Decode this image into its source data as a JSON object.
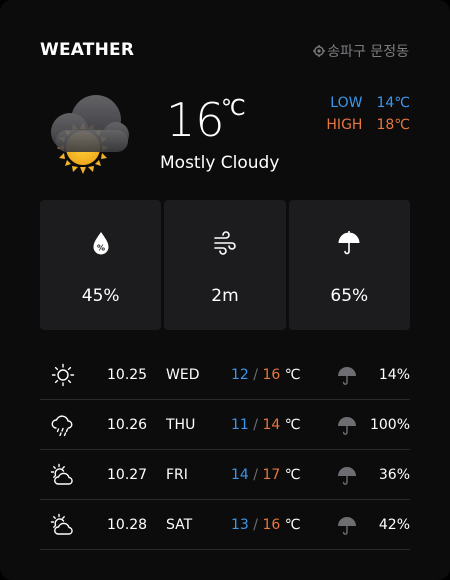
{
  "header": {
    "title": "WEATHER",
    "location": "송파구 문정동"
  },
  "current": {
    "temperature": "16",
    "unit": "℃",
    "condition": "Mostly Cloudy",
    "icon": "cloud-with-sun-icon",
    "low_label": "LOW",
    "low_value": "14℃",
    "high_label": "HIGH",
    "high_value": "18℃"
  },
  "tiles": [
    {
      "icon": "humidity-drop-icon",
      "value": "45%"
    },
    {
      "icon": "wind-icon",
      "value": "2m"
    },
    {
      "icon": "umbrella-icon",
      "value": "65%"
    }
  ],
  "forecast": [
    {
      "icon": "sun-icon",
      "date": "10.25",
      "day": "WED",
      "low": "12",
      "high": "16",
      "unit": "℃",
      "precip_icon": "umbrella-icon",
      "precip": "14%"
    },
    {
      "icon": "rain-cloud-icon",
      "date": "10.26",
      "day": "THU",
      "low": "11",
      "high": "14",
      "unit": "℃",
      "precip_icon": "umbrella-icon",
      "precip": "100%"
    },
    {
      "icon": "partly-cloudy-icon",
      "date": "10.27",
      "day": "FRI",
      "low": "14",
      "high": "17",
      "unit": "℃",
      "precip_icon": "umbrella-icon",
      "precip": "36%"
    },
    {
      "icon": "partly-cloudy-icon",
      "date": "10.28",
      "day": "SAT",
      "low": "13",
      "high": "16",
      "unit": "℃",
      "precip_icon": "umbrella-icon",
      "precip": "42%"
    }
  ],
  "colors": {
    "low": "#3b97ea",
    "high": "#e8763f",
    "tile": "#1c1c1e",
    "background": "#0c0c0d"
  }
}
